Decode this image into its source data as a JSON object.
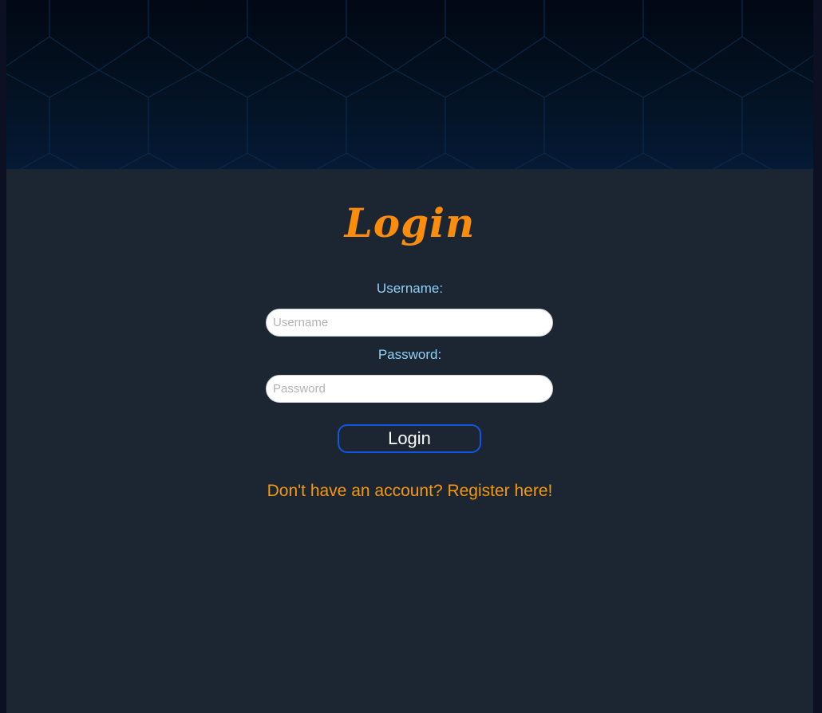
{
  "colors": {
    "accent_orange": "#fb8c0c",
    "label_blue": "#8fd0f4",
    "button_border": "#1256e0",
    "panel_bg": "#1c2633",
    "hero_bg": "#030b18"
  },
  "login": {
    "title": "Login",
    "username_label": "Username:",
    "username_placeholder": "Username",
    "username_value": "",
    "password_label": "Password:",
    "password_placeholder": "Password",
    "password_value": "",
    "submit_label": "Login",
    "register_link": "Don't have an account? Register here!"
  }
}
